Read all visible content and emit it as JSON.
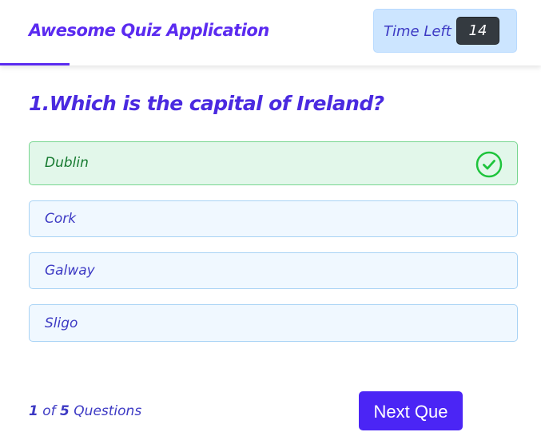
{
  "header": {
    "title": "Awesome Quiz Application",
    "timer_label": "Time Left",
    "timer_value": "14"
  },
  "question": {
    "text": "1.Which is the capital of Ireland?",
    "options": [
      {
        "label": "Dublin",
        "state": "correct"
      },
      {
        "label": "Cork",
        "state": "default"
      },
      {
        "label": "Galway",
        "state": "default"
      },
      {
        "label": "Sligo",
        "state": "default"
      }
    ]
  },
  "footer": {
    "current": "1",
    "of_text": "of",
    "total": "5",
    "questions_text": "Questions",
    "next_label": "Next Que"
  },
  "colors": {
    "accent": "#5b2bf0",
    "correct": "#1ec43c",
    "button": "#4b25f5"
  },
  "icons": {
    "correct_icon": "check-circle-icon"
  }
}
